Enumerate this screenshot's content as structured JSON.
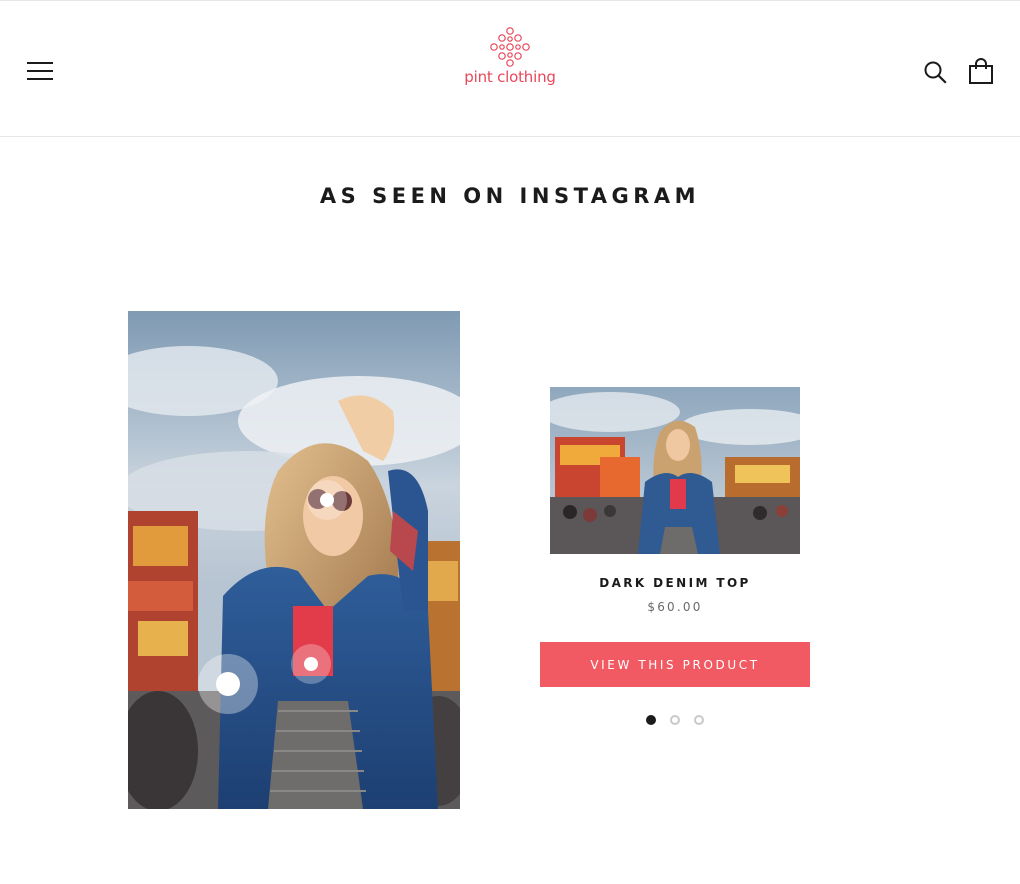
{
  "brand": {
    "logo_text": "pint clothing",
    "logo_color": "#e8475a"
  },
  "header": {
    "menu_icon": "hamburger-menu-icon",
    "search_icon": "search-icon",
    "cart_icon": "shopping-bag-icon"
  },
  "section": {
    "title": "AS SEEN ON INSTAGRAM"
  },
  "lookbook": {
    "image_description": "woman in denim jacket and sunglasses at a fair",
    "hotspot_count": 3
  },
  "product": {
    "title": "DARK DENIM TOP",
    "price": "$60.00",
    "button_label": "VIEW THIS PRODUCT",
    "button_color": "#f25a63"
  },
  "carousel": {
    "slides": 3,
    "active_index": 0
  }
}
